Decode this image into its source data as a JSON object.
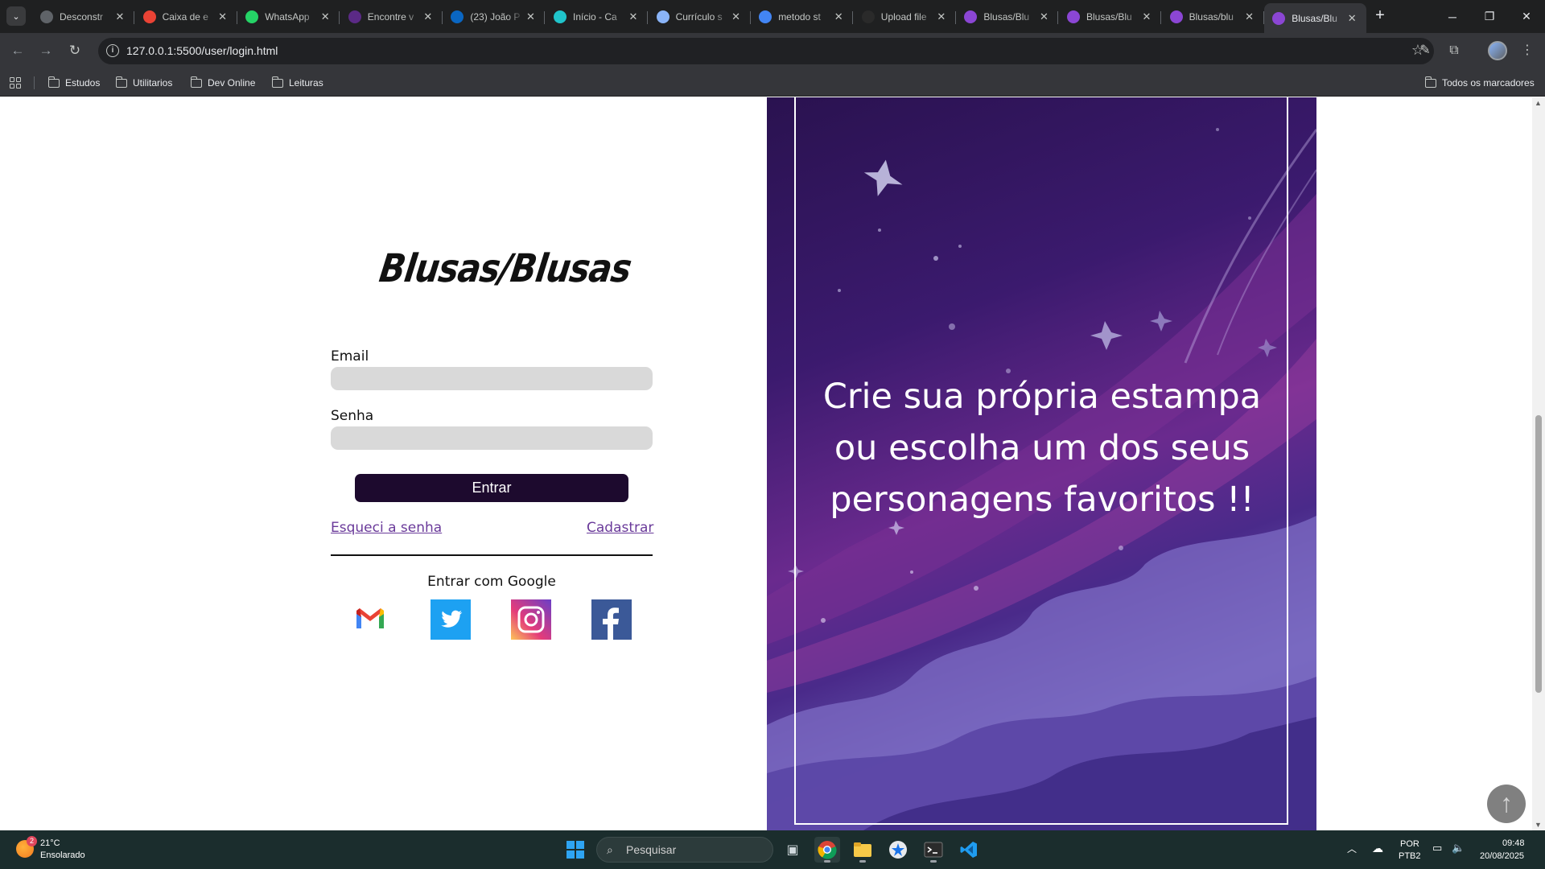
{
  "browser": {
    "tabs": [
      {
        "title": "Desconstr",
        "favicon": "globe-icon",
        "color": "#5f6368"
      },
      {
        "title": "Caixa de e",
        "favicon": "gmail-icon",
        "color": "#ea4335"
      },
      {
        "title": "WhatsApp",
        "favicon": "whatsapp-icon",
        "color": "#25d366"
      },
      {
        "title": "Encontre v",
        "favicon": "circle-icon",
        "color": "#5b2a86"
      },
      {
        "title": "(23) João P",
        "favicon": "linkedin-icon",
        "color": "#0a66c2"
      },
      {
        "title": "Início - Ca",
        "favicon": "canva-icon",
        "color": "#20c4cb"
      },
      {
        "title": "Currículo s",
        "favicon": "printer-icon",
        "color": "#8ab4f8"
      },
      {
        "title": "metodo st",
        "favicon": "google-icon",
        "color": "#4285f4"
      },
      {
        "title": "Upload file",
        "favicon": "github-icon",
        "color": "#2a2a2a"
      },
      {
        "title": "Blusas/Blu",
        "favicon": "shirt-icon",
        "color": "#8b46d4"
      },
      {
        "title": "Blusas/Blu",
        "favicon": "shirt-icon",
        "color": "#8b46d4"
      },
      {
        "title": "Blusas/blu",
        "favicon": "shirt-icon",
        "color": "#8b46d4"
      },
      {
        "title": "Blusas/Blu",
        "favicon": "shirt-icon",
        "color": "#8b46d4",
        "active": true
      }
    ],
    "url": "127.0.0.1:5500/user/login.html",
    "bookmarks": [
      "Estudos",
      "Utilitarios",
      "Dev Online",
      "Leituras"
    ],
    "all_bookmarks": "Todos os marcadores"
  },
  "page": {
    "logo": "Blusas/Blusas",
    "email_label": "Email",
    "email_value": "",
    "password_label": "Senha",
    "password_value": "",
    "submit_label": "Entrar",
    "forgot_label": "Esqueci a senha",
    "register_label": "Cadastrar",
    "social_label": "Entrar com Google",
    "social_icons": [
      "gmail-icon",
      "twitter-icon",
      "instagram-icon",
      "facebook-icon"
    ],
    "hero_text": "Crie sua própria estampa ou escolha um dos seus personagens favoritos !!",
    "colors": {
      "button": "#1d0a2e",
      "link": "#6a3a9a",
      "input": "#d9d9d9",
      "hero_dark": "#2a1250",
      "hero_accent": "#6a2a8e"
    }
  },
  "taskbar": {
    "weather_temp": "21°C",
    "weather_desc": "Ensolarado",
    "weather_badge": "2",
    "search_placeholder": "Pesquisar",
    "lang_top": "POR",
    "lang_bottom": "PTB2",
    "time": "09:48",
    "date": "20/08/2025"
  }
}
